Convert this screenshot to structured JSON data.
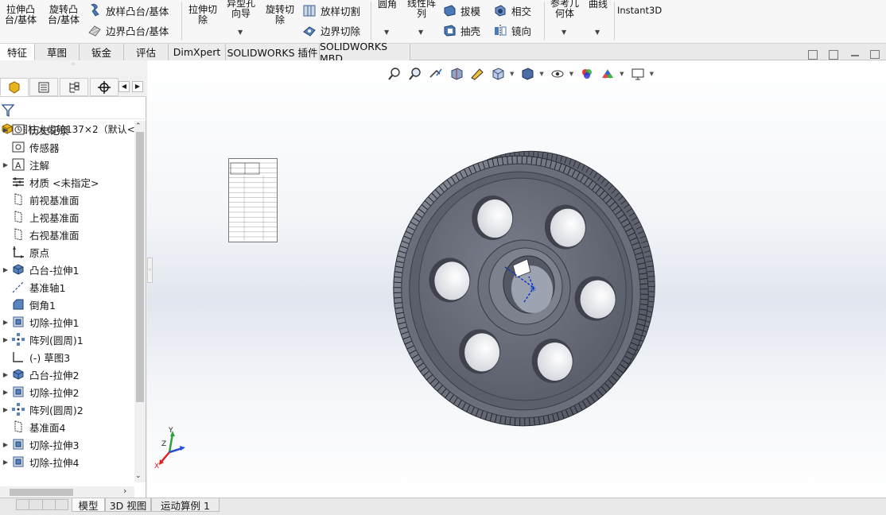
{
  "ribbon": {
    "extrude_boss": "拉伸凸\n台/基体",
    "revolve_boss": "旋转凸\n台/基体",
    "swept_boss": "放样凸台/基体",
    "boundary_boss": "边界凸台/基体",
    "extrude_cut": "拉伸切\n除",
    "hole_wizard": "异型孔\n向导",
    "revolve_cut": "旋转切\n除",
    "swept_cut": "放样切割",
    "boundary_cut": "边界切除",
    "fillet": "圆角",
    "linear_pattern": "线性阵\n列",
    "draft": "拔模",
    "shell": "抽壳",
    "intersect": "相交",
    "mirror": "镜向",
    "reference_geometry": "参考几\n何体",
    "curves": "曲线",
    "instant3d": "Instant3D"
  },
  "tabs": [
    "特征",
    "草图",
    "钣金",
    "评估",
    "DimXpert",
    "SOLIDWORKS 插件",
    "SOLIDWORKS MBD"
  ],
  "tree": {
    "root": "圆柱大齿轮137×2（默认<<",
    "items": [
      {
        "label": "历史记录",
        "icon": "history-icon",
        "expandable": true
      },
      {
        "label": "传感器",
        "icon": "sensor-icon",
        "expandable": false
      },
      {
        "label": "注解",
        "icon": "annotation-icon",
        "expandable": true
      },
      {
        "label": "材质 <未指定>",
        "icon": "material-icon",
        "expandable": false
      },
      {
        "label": "前视基准面",
        "icon": "plane-icon",
        "expandable": false
      },
      {
        "label": "上视基准面",
        "icon": "plane-icon",
        "expandable": false
      },
      {
        "label": "右视基准面",
        "icon": "plane-icon",
        "expandable": false
      },
      {
        "label": "原点",
        "icon": "origin-icon",
        "expandable": false
      },
      {
        "label": "凸台-拉伸1",
        "icon": "boss-extrude-icon",
        "expandable": true
      },
      {
        "label": "基准轴1",
        "icon": "axis-icon",
        "expandable": false
      },
      {
        "label": "倒角1",
        "icon": "chamfer-icon",
        "expandable": false
      },
      {
        "label": "切除-拉伸1",
        "icon": "cut-extrude-icon",
        "expandable": true
      },
      {
        "label": "阵列(圆周)1",
        "icon": "circular-pattern-icon",
        "expandable": true
      },
      {
        "label": "(-) 草图3",
        "icon": "sketch-icon",
        "expandable": false
      },
      {
        "label": "凸台-拉伸2",
        "icon": "boss-extrude-icon",
        "expandable": true
      },
      {
        "label": "切除-拉伸2",
        "icon": "cut-extrude-icon",
        "expandable": true
      },
      {
        "label": "阵列(圆周)2",
        "icon": "circular-pattern-icon",
        "expandable": true
      },
      {
        "label": "基准面4",
        "icon": "plane-icon",
        "expandable": false
      },
      {
        "label": "切除-拉伸3",
        "icon": "cut-extrude-icon",
        "expandable": true
      },
      {
        "label": "切除-拉伸4",
        "icon": "cut-extrude-icon",
        "expandable": true
      }
    ]
  },
  "bottom_tabs": [
    "模型",
    "3D 视图",
    "运动算例 1"
  ],
  "triad": {
    "x": "X",
    "y": "Y",
    "z": "Z"
  },
  "colors": {
    "gear": "#6d7180",
    "accent": "#d69a00"
  }
}
